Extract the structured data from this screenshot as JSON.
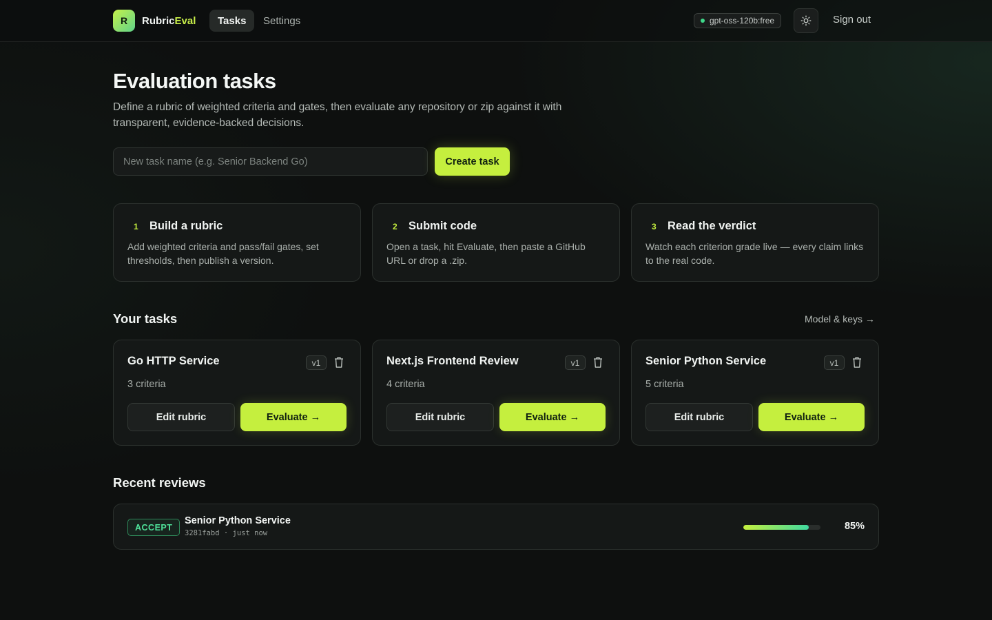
{
  "brand": {
    "logo_letter": "R",
    "name_main": "Rubric",
    "name_accent": "Eval"
  },
  "nav": {
    "tabs": [
      {
        "label": "Tasks",
        "active": true
      },
      {
        "label": "Settings",
        "active": false
      }
    ]
  },
  "header": {
    "model": "gpt-oss-120b:free",
    "theme_icon": "sun-icon",
    "sign_out": "Sign out"
  },
  "hero": {
    "title": "Evaluation tasks",
    "subtitle": "Define a rubric of weighted criteria and gates, then evaluate any repository or zip against it with transparent, evidence-backed decisions.",
    "input_placeholder": "New task name (e.g. Senior Backend Go)",
    "input_value": "",
    "create_label": "Create task"
  },
  "steps": [
    {
      "num": "1",
      "title": "Build a rubric",
      "desc": "Add weighted criteria and pass/fail gates, set thresholds, then publish a version."
    },
    {
      "num": "2",
      "title": "Submit code",
      "desc": "Open a task, hit Evaluate, then paste a GitHub URL or drop a .zip."
    },
    {
      "num": "3",
      "title": "Read the verdict",
      "desc": "Watch each criterion grade live — every claim links to the real code."
    }
  ],
  "your_tasks": {
    "title": "Your tasks",
    "model_link": "Model & keys →",
    "items": [
      {
        "name": "Go HTTP Service",
        "version": "v1",
        "criteria": "3 criteria",
        "edit_label": "Edit rubric",
        "evaluate_label": "Evaluate →"
      },
      {
        "name": "Next.js Frontend Review",
        "version": "v1",
        "criteria": "4 criteria",
        "edit_label": "Edit rubric",
        "evaluate_label": "Evaluate →"
      },
      {
        "name": "Senior Python Service",
        "version": "v1",
        "criteria": "5 criteria",
        "edit_label": "Edit rubric",
        "evaluate_label": "Evaluate →"
      }
    ]
  },
  "recent_reviews": {
    "title": "Recent reviews",
    "items": [
      {
        "verdict": "ACCEPT",
        "task": "Senior Python Service",
        "meta": "3281fabd · just now",
        "score_label": "85%",
        "score": 0.85
      }
    ]
  },
  "colors": {
    "accent": "#c5ef3e",
    "success": "#4fe29a",
    "background": "#0e100f"
  }
}
